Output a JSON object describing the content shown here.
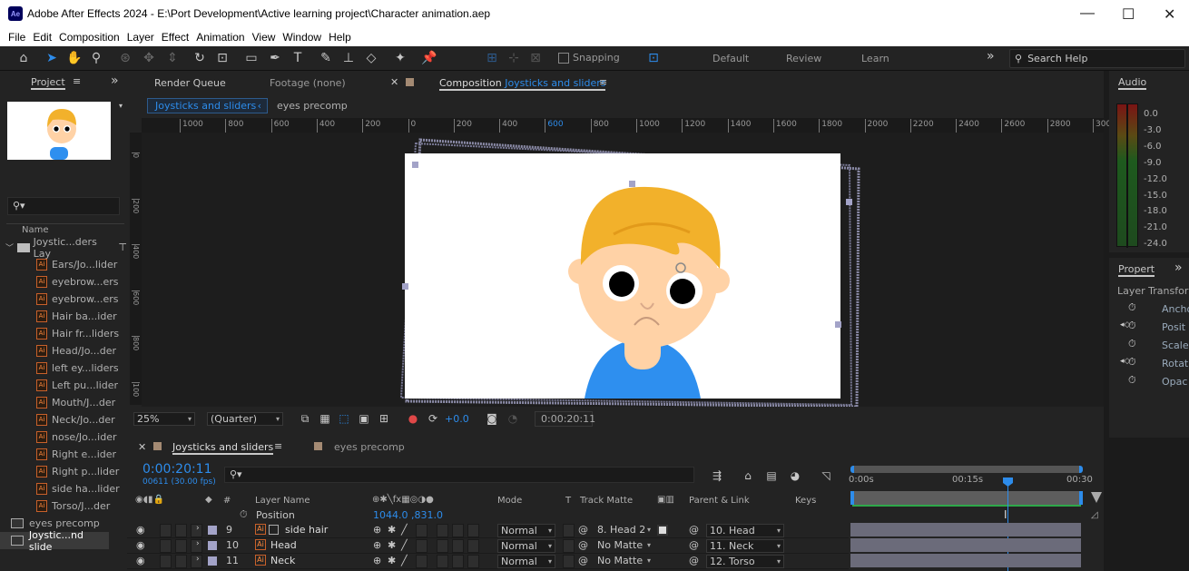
{
  "titlebar": {
    "logo": "Ae",
    "title": "Adobe After Effects 2024 - E:\\Port Development\\Active learning project\\Character animation.aep",
    "minimize": "—",
    "maximize": "☐",
    "close": "✕"
  },
  "menu": [
    "File",
    "Edit",
    "Composition",
    "Layer",
    "Effect",
    "Animation",
    "View",
    "Window",
    "Help"
  ],
  "toolbar": {
    "snapping": "Snapping",
    "workspaces": [
      "Default",
      "Review",
      "Learn"
    ],
    "search_placeholder": "Search Help",
    "more": "»"
  },
  "project": {
    "tab": "Project",
    "name_header": "Name",
    "folder": "Joystic...ders Lay",
    "items": [
      "Ears/Jo...lider",
      "eyebrow...ers",
      "eyebrow...ers",
      "Hair ba...ider",
      "Hair fr...liders",
      "Head/Jo...der",
      "left ey...liders",
      "Left pu...lider",
      "Mouth/J...der",
      "Neck/Jo...der",
      "nose/Jo...ider",
      "Right e...ider",
      "Right p...lider",
      "side ha...lider",
      "Torso/J...der"
    ],
    "comps": [
      "eyes precomp",
      "Joystic...nd slide"
    ]
  },
  "viewer": {
    "tabs": {
      "render_queue": "Render Queue",
      "footage": "Footage (none)",
      "composition_prefix": "Composition",
      "composition_name": "Joysticks and sliders"
    },
    "breadcrumbs": [
      "Joysticks and sliders",
      "eyes precomp"
    ],
    "hruler": [
      "1000",
      "800",
      "600",
      "400",
      "200",
      "0",
      "200",
      "400",
      "600",
      "800",
      "1000",
      "1200",
      "1400",
      "1600",
      "1800",
      "2000",
      "2200",
      "2400",
      "2600",
      "2800",
      "300"
    ],
    "vruler": [
      "0",
      "200",
      "400",
      "600",
      "800",
      "100"
    ],
    "zoom": "25%",
    "resolution": "(Quarter)",
    "exposure": "+0.0",
    "timecode": "0:00:20:11"
  },
  "timeline": {
    "tabs": [
      "Joysticks and sliders",
      "eyes precomp"
    ],
    "timecode": "0:00:20:11",
    "frames": "00611 (30.00 fps)",
    "columns": {
      "layer_name": "Layer Name",
      "mode": "Mode",
      "t": "T",
      "track_matte": "Track Matte",
      "parent": "Parent & Link",
      "keys": "Keys",
      "num": "#"
    },
    "position_label": "Position",
    "position_value": "1044.0 ,831.0",
    "time_labels": [
      "0:00s",
      "00:15s",
      "00:30"
    ],
    "layers": [
      {
        "num": "9",
        "name": "side hair",
        "mode": "Normal",
        "matte": "8. Head 2",
        "parent": "10. Head"
      },
      {
        "num": "10",
        "name": "Head",
        "mode": "Normal",
        "matte": "No Matte",
        "parent": "11. Neck"
      },
      {
        "num": "11",
        "name": "Neck",
        "mode": "Normal",
        "matte": "No Matte",
        "parent": "12. Torso"
      }
    ]
  },
  "audio": {
    "tab": "Audio",
    "levels": [
      "0.0",
      "-3.0",
      "-6.0",
      "-9.0",
      "-12.0",
      "-15.0",
      "-18.0",
      "-21.0",
      "-24.0"
    ]
  },
  "properties": {
    "tab": "Propert",
    "group": "Layer Transfor",
    "rows": [
      "Ancho",
      "Posit",
      "Scale",
      "Rotat",
      "Opac"
    ]
  },
  "colors": {
    "accent": "#2d8ceb",
    "panel": "#232323",
    "hair": "#f2b12b",
    "skin": "#ffd2a6",
    "shirt": "#2e8fef"
  }
}
